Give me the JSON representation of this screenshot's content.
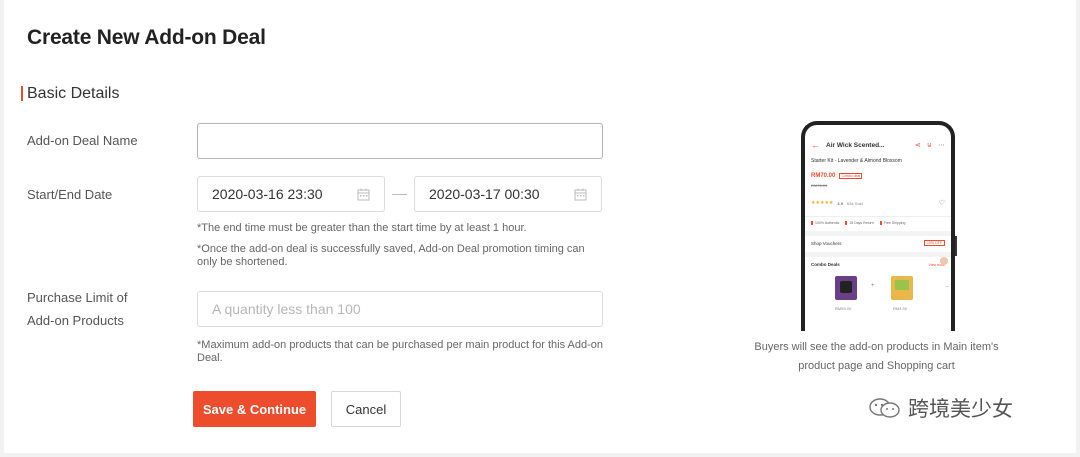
{
  "page": {
    "title": "Create New Add-on Deal",
    "section_title": "Basic Details"
  },
  "form": {
    "deal_name": {
      "label": "Add-on Deal Name",
      "value": "",
      "placeholder": ""
    },
    "dates": {
      "label": "Start/End Date",
      "start": "2020-03-16 23:30",
      "end": "2020-03-17 00:30",
      "hint1": "*The end time must be greater than the start time by at least 1 hour.",
      "hint2": "*Once the add-on deal is successfully saved, Add-on Deal promotion timing can only be shortened."
    },
    "purchase_limit": {
      "label_line1": "Purchase Limit of",
      "label_line2": "Add-on Products",
      "placeholder": "A quantity less than 100",
      "hint": "*Maximum add-on products that can be purchased per main product for this Add-on Deal."
    }
  },
  "buttons": {
    "save": "Save & Continue",
    "cancel": "Cancel"
  },
  "preview": {
    "caption": "Buyers will see the add-on products in Main item's product page and Shopping cart",
    "phone": {
      "header_title": "Air Wick Scented...",
      "product_name": "Starter Kit - Lavender & Almond Blossom",
      "price": "RM70.00",
      "price_badge": "Combo deal",
      "old_price": "RM76.00",
      "rating": "4.9",
      "sold": "634 Sold",
      "badges": [
        "100% Authentic",
        "15 Days Return",
        "Free Shipping"
      ],
      "shop_vouchers": "Shop Vouchers",
      "voucher_tag": "10% OFF",
      "combo_label": "Combo Deals",
      "view_more": "View more",
      "item1_price": "RM59.00",
      "item2_price": "RM4.90"
    }
  },
  "watermark": "跨境美少女",
  "colors": {
    "accent": "#ee4d2d"
  }
}
